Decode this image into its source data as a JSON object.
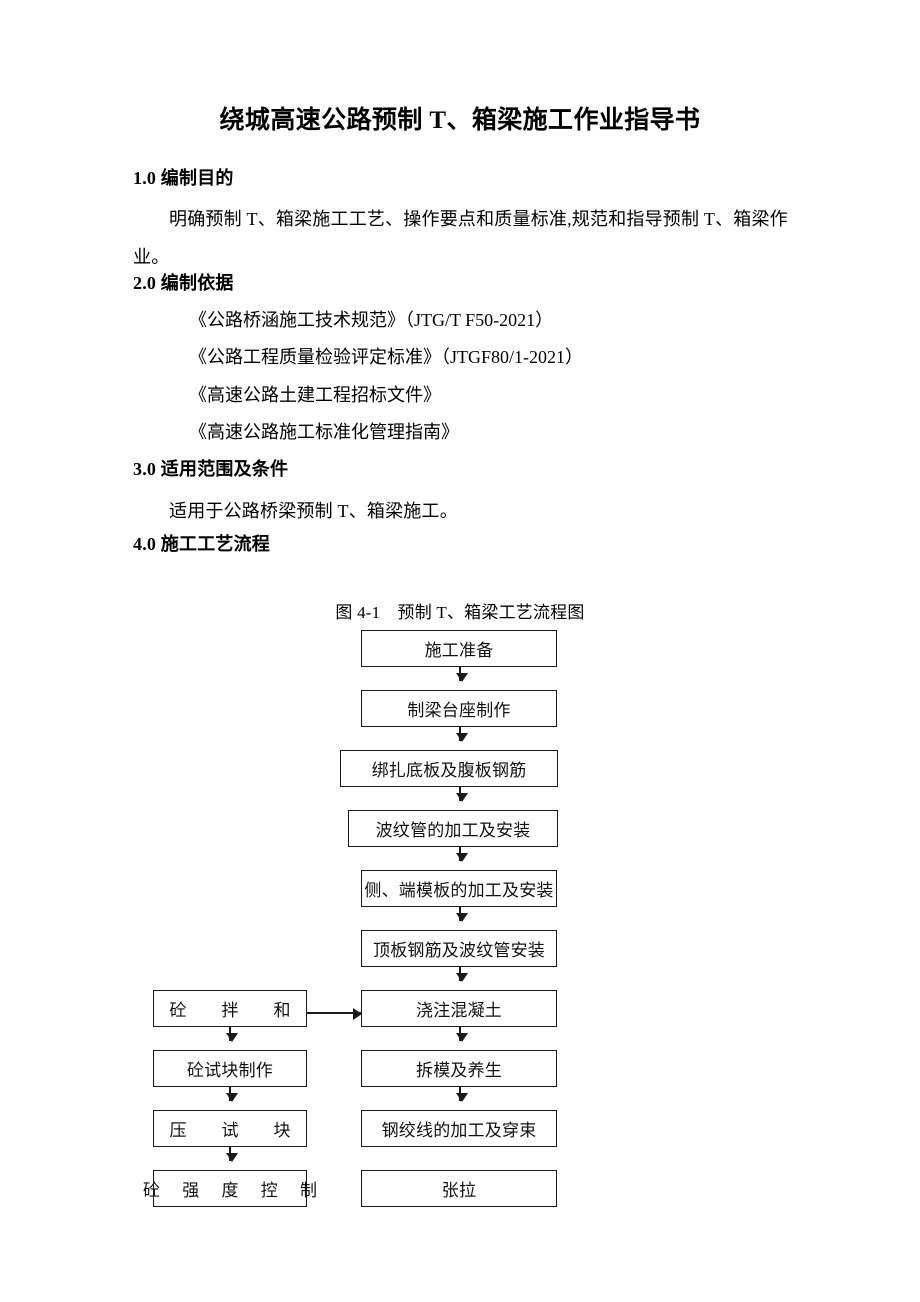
{
  "document": {
    "title": "绕城高速公路预制 T、箱梁施工作业指导书"
  },
  "sections": {
    "s1": {
      "heading": "1.0 编制目的",
      "body": "明确预制 T、箱梁施工工艺、操作要点和质量标准,规范和指导预制 T、箱梁作业。"
    },
    "s2": {
      "heading": "2.0 编制依据",
      "refs": [
        "《公路桥涵施工技术规范》（JTG/T F50-2021）",
        "《公路工程质量检验评定标准》（JTGF80/1-2021）",
        "《高速公路土建工程招标文件》",
        "《高速公路施工标准化管理指南》"
      ]
    },
    "s3": {
      "heading": "3.0 适用范围及条件",
      "body": "适用于公路桥梁预制 T、箱梁施工。"
    },
    "s4": {
      "heading": "4.0 施工工艺流程"
    }
  },
  "figure": {
    "caption": "图 4-1　预制 T、箱梁工艺流程图",
    "main_nodes": [
      "施工准备",
      "制梁台座制作",
      "绑扎底板及腹板钢筋",
      "波纹管的加工及安装",
      "侧、端模板的加工及安装",
      "顶板钢筋及波纹管安装",
      "浇注混凝土",
      "拆模及养生",
      "钢绞线的加工及穿束",
      "张拉"
    ],
    "side_nodes": [
      "砼　拌　和",
      "砼试块制作",
      "压　试　块",
      "砼 强 度 控 制"
    ]
  }
}
